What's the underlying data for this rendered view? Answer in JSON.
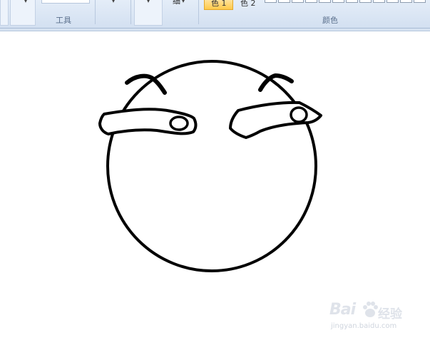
{
  "ribbon": {
    "tools_group_label": "工具",
    "colors_group_label": "颜色",
    "brush_fragment": "细",
    "color1_label": "色 1",
    "color2_label": "色 2"
  },
  "colors": {
    "stroke": "#000000",
    "selected_color_highlight": "#ffc94a"
  },
  "watermark": {
    "brand": "Bai",
    "brand_cn": "经验",
    "url": "jingyan.baidu.com"
  }
}
